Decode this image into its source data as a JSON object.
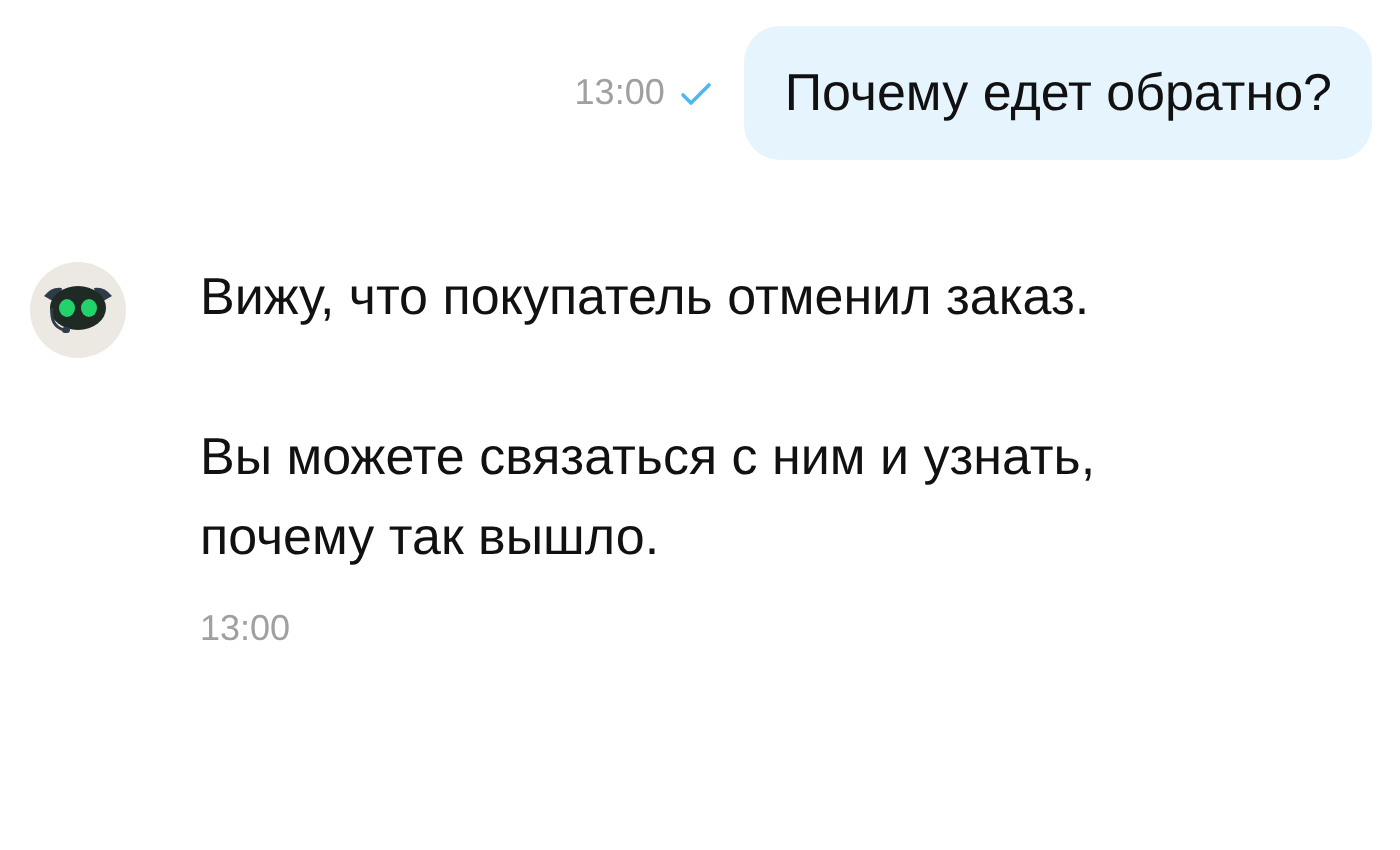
{
  "messages": [
    {
      "kind": "outgoing",
      "time": "13:00",
      "read": true,
      "paragraphs": [
        "Почему едет обратно?"
      ]
    },
    {
      "kind": "incoming",
      "time": "13:00",
      "paragraphs": [
        "Вижу, что покупатель отменил заказ.",
        "Вы можете связаться с ним и узнать, почему так вышло."
      ]
    }
  ]
}
